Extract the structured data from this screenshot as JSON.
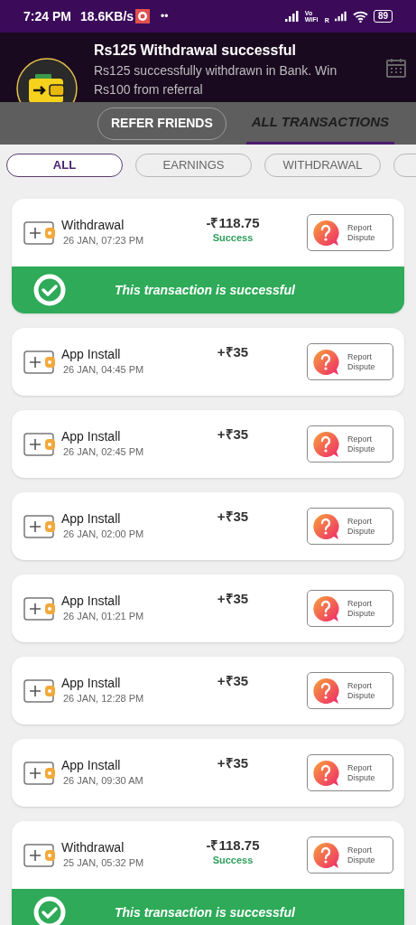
{
  "status_bar": {
    "time": "7:24 PM",
    "speed": "18.6KB/s",
    "dots": "••",
    "wifi_calling": "Vo WiFi",
    "roaming": "R",
    "battery": "89"
  },
  "notification": {
    "title": "Rs125 Withdrawal successful",
    "body": "Rs125 successfully withdrawn in Bank. Win Rs100 from referral",
    "button": "REFER FRIENDS"
  },
  "tabs": [
    {
      "label": "ALL TRANSACTIONS",
      "selected": true
    }
  ],
  "filters": [
    {
      "label": "ALL",
      "selected": true
    },
    {
      "label": "EARNINGS",
      "selected": false
    },
    {
      "label": "WITHDRAWAL",
      "selected": false
    },
    {
      "selected": false
    }
  ],
  "transactions": [
    {
      "kind": "withdrawal",
      "title": "Withdrawal",
      "time": "26 JAN, 07:23 PM",
      "amount": "-₹118.75",
      "status": "Success",
      "banner": "This transaction is successful",
      "report": "Report Dispute"
    },
    {
      "kind": "earning",
      "title": "App Install",
      "time": "26 JAN, 04:45 PM",
      "amount": "+₹35",
      "report": "Report Dispute"
    },
    {
      "kind": "earning",
      "title": "App Install",
      "time": "26 JAN, 02:45 PM",
      "amount": "+₹35",
      "report": "Report Dispute"
    },
    {
      "kind": "earning",
      "title": "App Install",
      "time": "26 JAN, 02:00 PM",
      "amount": "+₹35",
      "report": "Report Dispute"
    },
    {
      "kind": "earning",
      "title": "App Install",
      "time": "26 JAN, 01:21 PM",
      "amount": "+₹35",
      "report": "Report Dispute"
    },
    {
      "kind": "earning",
      "title": "App Install",
      "time": "26 JAN, 12:28 PM",
      "amount": "+₹35",
      "report": "Report Dispute"
    },
    {
      "kind": "earning",
      "title": "App Install",
      "time": "26 JAN, 09:30 AM",
      "amount": "+₹35",
      "report": "Report Dispute"
    },
    {
      "kind": "withdrawal",
      "title": "Withdrawal",
      "time": "25 JAN, 05:32 PM",
      "amount": "-₹118.75",
      "status": "Success",
      "banner": "This transaction is successful",
      "report": "Report Dispute"
    }
  ]
}
